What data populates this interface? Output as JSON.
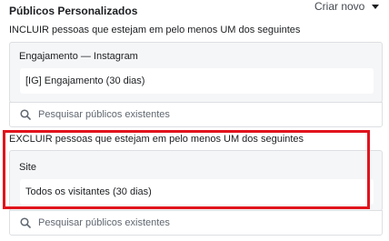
{
  "header": {
    "title": "Públicos Personalizados",
    "create_new_label": "Criar novo"
  },
  "include": {
    "instruction": "INCLUIR pessoas que estejam em pelo menos UM dos seguintes",
    "group_label": "Engajamento — Instagram",
    "selected": "[IG] Engajamento (30 dias)",
    "search_placeholder": "Pesquisar públicos existentes"
  },
  "exclude": {
    "instruction": "EXCLUIR pessoas que estejam em pelo menos UM dos seguintes",
    "group_label": "Site",
    "selected": "Todos os visitantes (30 dias)",
    "search_placeholder": "Pesquisar públicos existentes"
  },
  "colors": {
    "highlight": "#e1141d",
    "group_bg": "#f5f6f7",
    "border": "#dddfe2"
  },
  "icons": {
    "search": "search-icon",
    "dropdown": "caret-down-icon"
  }
}
